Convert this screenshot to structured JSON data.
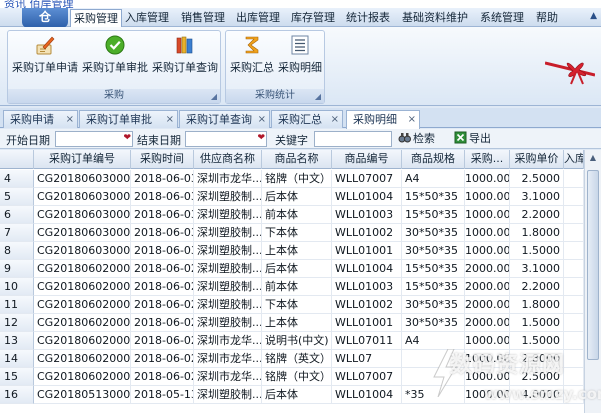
{
  "breadcrumb": {
    "text": "资讯  佰岸管理"
  },
  "app": {
    "orb_label": "仓"
  },
  "menubar": {
    "items": [
      "采购管理",
      "入库管理",
      "销售管理",
      "出库管理",
      "库存管理",
      "统计报表",
      "基础资料维护",
      "系统管理",
      "帮助"
    ],
    "active": "采购管理"
  },
  "ribbon": {
    "groups": [
      {
        "label": "采购",
        "buttons": [
          "采购订单申请",
          "采购订单审批",
          "采购订单查询"
        ]
      },
      {
        "label": "采购统计",
        "buttons": [
          "采购汇总",
          "采购明细"
        ]
      }
    ]
  },
  "doc_tabs": {
    "items": [
      "采购申请",
      "采购订单审批",
      "采购订单查询",
      "采购汇总",
      "采购明细"
    ],
    "active": "采购明细"
  },
  "filter": {
    "start_label": "开始日期",
    "end_label": "结束日期",
    "keyword_label": "关键字",
    "search_label": "检索",
    "export_label": "导出"
  },
  "grid": {
    "columns": [
      "",
      "采购订单编号",
      "采购时间",
      "供应商名称",
      "商品名称",
      "商品编号",
      "商品规格",
      "采购...",
      "采购单价",
      "入库"
    ],
    "rows": [
      [
        "4",
        "CG201806030002",
        "2018-06-03",
        "深圳市龙华...",
        "铭牌（中文）",
        "WLL07007",
        "A4",
        "1000.00",
        "2.5000",
        ""
      ],
      [
        "5",
        "CG201806030001",
        "2018-06-03",
        "深圳塑胶制...",
        "后本体",
        "WLL01004",
        "15*50*35",
        "1000.00",
        "3.1000",
        ""
      ],
      [
        "6",
        "CG201806030001",
        "2018-06-03",
        "深圳塑胶制...",
        "前本体",
        "WLL01003",
        "15*50*35",
        "1000.00",
        "2.2000",
        ""
      ],
      [
        "7",
        "CG201806030001",
        "2018-06-03",
        "深圳塑胶制...",
        "下本体",
        "WLL01002",
        "30*50*35",
        "1000.00",
        "1.8000",
        ""
      ],
      [
        "8",
        "CG201806030001",
        "2018-06-03",
        "深圳塑胶制...",
        "上本体",
        "WLL01001",
        "30*50*35",
        "1000.00",
        "1.5000",
        ""
      ],
      [
        "9",
        "CG201806020002",
        "2018-06-02",
        "深圳塑胶制...",
        "后本体",
        "WLL01004",
        "15*50*35",
        "2000.00",
        "3.1000",
        ""
      ],
      [
        "10",
        "CG201806020002",
        "2018-06-02",
        "深圳塑胶制...",
        "前本体",
        "WLL01003",
        "15*50*35",
        "2000.00",
        "2.2000",
        ""
      ],
      [
        "11",
        "CG201806020002",
        "2018-06-02",
        "深圳塑胶制...",
        "下本体",
        "WLL01002",
        "30*50*35",
        "2000.00",
        "1.8000",
        ""
      ],
      [
        "12",
        "CG201806020002",
        "2018-06-02",
        "深圳塑胶制...",
        "上本体",
        "WLL01001",
        "30*50*35",
        "2000.00",
        "1.5000",
        ""
      ],
      [
        "13",
        "CG201806020001",
        "2018-06-02",
        "深圳市龙华...",
        "说明书(中文)",
        "WLL07011",
        "A4",
        "1000.00",
        "1.5000",
        ""
      ],
      [
        "14",
        "CG201806020001",
        "2018-06-02",
        "深圳市龙华...",
        "铭牌（英文）",
        "WLL07",
        "",
        "1000.00",
        "2.8000",
        ""
      ],
      [
        "15",
        "CG201806020001",
        "2018-06-02",
        "深圳市龙华...",
        "铭牌（中文）",
        "WLL07007",
        "",
        "1000.00",
        "2.5000",
        ""
      ],
      [
        "16",
        "CG201805130001",
        "2018-05-13",
        "深圳塑胶制...",
        "后本体",
        "WLL01004",
        "*35",
        "1000.00",
        "4.0000",
        ""
      ]
    ]
  },
  "watermark": {
    "line1": "数码资源网",
    "line2": "www.smzy.com"
  }
}
